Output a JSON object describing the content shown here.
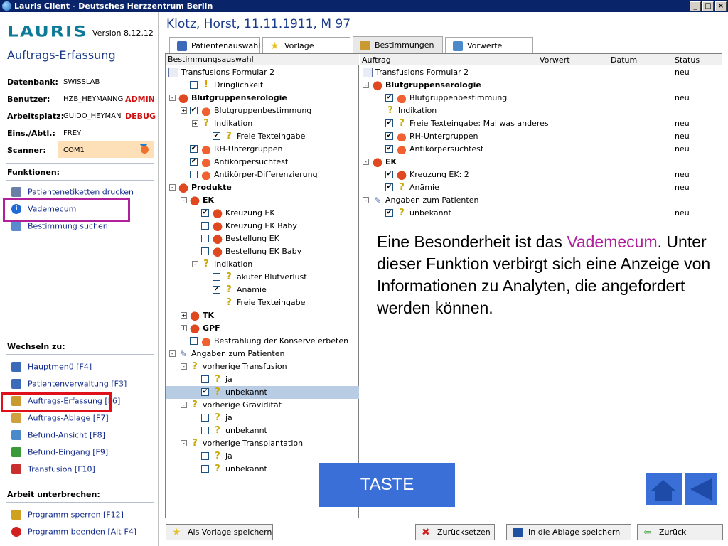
{
  "window": {
    "title": "Lauris Client - Deutsches Herzzentrum Berlin"
  },
  "left": {
    "logo": "LAURIS",
    "version": "Version 8.12.12",
    "module_title": "Auftrags-Erfassung",
    "info": [
      {
        "label": "Datenbank:",
        "value": "SWISSLAB",
        "flag": ""
      },
      {
        "label": "Benutzer:",
        "value": "HZB_HEYMANNG",
        "flag": "ADMIN"
      },
      {
        "label": "Arbeitsplatz:",
        "value": "GUIDO_HEYMAN",
        "flag": "DEBUG"
      },
      {
        "label": "Eins./Abtl.:",
        "value": "FREY",
        "flag": ""
      },
      {
        "label": "Scanner:",
        "value": "COM1",
        "flag": ""
      }
    ],
    "functions_head": "Funktionen:",
    "functions": [
      {
        "label": "Patientenetiketten drucken",
        "icon": "printer-icon"
      },
      {
        "label": "Vademecum",
        "icon": "info-icon"
      },
      {
        "label": "Bestimmung suchen",
        "icon": "magnifier-icon"
      }
    ],
    "switch_head": "Wechseln zu:",
    "switch": [
      {
        "label": "Hauptmenü [F4]",
        "icon": "main-menu-icon"
      },
      {
        "label": "Patientenverwaltung [F3]",
        "icon": "person-icon"
      },
      {
        "label": "Auftrags-Erfassung [F6]",
        "icon": "edit-icon"
      },
      {
        "label": "Auftrags-Ablage [F7]",
        "icon": "archive-icon"
      },
      {
        "label": "Befund-Ansicht [F8]",
        "icon": "report-icon"
      },
      {
        "label": "Befund-Eingang [F9]",
        "icon": "inbox-icon"
      },
      {
        "label": "Transfusion [F10]",
        "icon": "transfusion-icon"
      }
    ],
    "pause_head": "Arbeit unterbrechen:",
    "pause": [
      {
        "label": "Programm sperren [F12]",
        "icon": "lock-icon"
      },
      {
        "label": "Programm beenden [Alt-F4]",
        "icon": "power-icon"
      }
    ]
  },
  "patient": {
    "title": "Klotz, Horst, 11.11.1911, M 97"
  },
  "tabs": [
    {
      "label": "Patientenauswahl",
      "icon": "person-icon"
    },
    {
      "label": "Vorlage",
      "icon": "star-icon"
    },
    {
      "label": "Bestimmungen",
      "icon": "edit-icon"
    },
    {
      "label": "Vorwerte",
      "icon": "report-icon"
    }
  ],
  "left_tree": {
    "header": "Bestimmungsauswahl",
    "rows": [
      {
        "text": "Transfusions Formular 2",
        "icon": "document-icon",
        "checked": null,
        "bold": false
      },
      {
        "text": "Dringlichkeit",
        "icon": "exclamation-icon",
        "checked": false,
        "bold": false
      },
      {
        "text": "Blutgruppenserologie",
        "icon": "blood-bag-icon",
        "checked": null,
        "bold": true
      },
      {
        "text": "Blutgruppenbestimmung",
        "icon": "blood-drop-icon",
        "checked": true,
        "bold": false
      },
      {
        "text": "Indikation",
        "icon": "question-icon",
        "checked": null,
        "bold": false
      },
      {
        "text": "Freie Texteingabe",
        "icon": "question-icon",
        "checked": true,
        "bold": false
      },
      {
        "text": "RH-Untergruppen",
        "icon": "blood-drop-icon",
        "checked": true,
        "bold": false
      },
      {
        "text": "Antikörpersuchtest",
        "icon": "blood-drop-icon",
        "checked": true,
        "bold": false
      },
      {
        "text": "Antikörper-Differenzierung",
        "icon": "blood-drop-icon",
        "checked": false,
        "bold": false
      },
      {
        "text": "Produkte",
        "icon": "blood-bag-icon",
        "checked": null,
        "bold": true
      },
      {
        "text": "EK",
        "icon": "blood-bag-icon",
        "checked": null,
        "bold": true
      },
      {
        "text": "Kreuzung EK",
        "icon": "blood-bag-icon",
        "checked": true,
        "bold": false
      },
      {
        "text": "Kreuzung EK Baby",
        "icon": "blood-bag-icon",
        "checked": false,
        "bold": false
      },
      {
        "text": "Bestellung EK",
        "icon": "blood-bag-icon",
        "checked": false,
        "bold": false
      },
      {
        "text": "Bestellung EK Baby",
        "icon": "blood-bag-icon",
        "checked": false,
        "bold": false
      },
      {
        "text": "Indikation",
        "icon": "question-icon",
        "checked": null,
        "bold": false
      },
      {
        "text": "akuter Blutverlust",
        "icon": "question-icon",
        "checked": false,
        "bold": false
      },
      {
        "text": "Anämie",
        "icon": "question-icon",
        "checked": true,
        "bold": false
      },
      {
        "text": "Freie Texteingabe",
        "icon": "question-icon",
        "checked": false,
        "bold": false
      },
      {
        "text": "TK",
        "icon": "blood-bag-icon",
        "checked": null,
        "bold": true
      },
      {
        "text": "GPF",
        "icon": "blood-bag-icon",
        "checked": null,
        "bold": true
      },
      {
        "text": "Bestrahlung der Konserve erbeten",
        "icon": "blood-drop-icon",
        "checked": false,
        "bold": false
      },
      {
        "text": "Angaben zum Patienten",
        "icon": "syringe-icon",
        "checked": null,
        "bold": false
      },
      {
        "text": "vorherige Transfusion",
        "icon": "question-icon",
        "checked": null,
        "bold": false
      },
      {
        "text": "ja",
        "icon": "question-icon",
        "checked": false,
        "bold": false
      },
      {
        "text": "unbekannt",
        "icon": "question-icon",
        "checked": true,
        "bold": false
      },
      {
        "text": "vorherige Gravidität",
        "icon": "question-icon",
        "checked": null,
        "bold": false
      },
      {
        "text": "ja",
        "icon": "question-icon",
        "checked": false,
        "bold": false
      },
      {
        "text": "unbekannt",
        "icon": "question-icon",
        "checked": false,
        "bold": false
      },
      {
        "text": "vorherige Transplantation",
        "icon": "question-icon",
        "checked": null,
        "bold": false
      },
      {
        "text": "ja",
        "icon": "question-icon",
        "checked": false,
        "bold": false
      },
      {
        "text": "unbekannt",
        "icon": "question-icon",
        "checked": false,
        "bold": false
      }
    ]
  },
  "right_table": {
    "headers": [
      "Auftrag",
      "Vorwert",
      "Datum",
      "Status"
    ],
    "rows": [
      {
        "text": "Transfusions Formular 2",
        "icon": "document-icon",
        "checked": null,
        "bold": false,
        "status": "neu"
      },
      {
        "text": "Blutgruppenserologie",
        "icon": "blood-bag-icon",
        "checked": null,
        "bold": true,
        "status": ""
      },
      {
        "text": "Blutgruppenbestimmung",
        "icon": "blood-drop-icon",
        "checked": true,
        "bold": false,
        "status": "neu"
      },
      {
        "text": "Indikation",
        "icon": "question-icon",
        "checked": null,
        "bold": false,
        "status": ""
      },
      {
        "text": "Freie Texteingabe: Mal was anderes",
        "icon": "question-icon",
        "checked": true,
        "bold": false,
        "status": "neu"
      },
      {
        "text": "RH-Untergruppen",
        "icon": "blood-drop-icon",
        "checked": true,
        "bold": false,
        "status": "neu"
      },
      {
        "text": "Antikörpersuchtest",
        "icon": "blood-drop-icon",
        "checked": true,
        "bold": false,
        "status": "neu"
      },
      {
        "text": "EK",
        "icon": "blood-bag-icon",
        "checked": null,
        "bold": true,
        "status": ""
      },
      {
        "text": "Kreuzung EK: 2",
        "icon": "blood-bag-icon",
        "checked": true,
        "bold": false,
        "status": "neu"
      },
      {
        "text": "Anämie",
        "icon": "question-icon",
        "checked": true,
        "bold": false,
        "status": "neu"
      },
      {
        "text": "Angaben zum Patienten",
        "icon": "syringe-icon",
        "checked": null,
        "bold": false,
        "status": ""
      },
      {
        "text": "unbekannt",
        "icon": "question-icon",
        "checked": true,
        "bold": false,
        "status": "neu"
      }
    ]
  },
  "overlay": {
    "text_before": "Eine Besonderheit ist das ",
    "text_highlight": "Vademecum",
    "text_after": ". Unter dieser Funktion verbirgt sich eine Anzeige von Informationen zu Analyten, die angefordert werden können.",
    "taste": "TASTE"
  },
  "bottom_buttons": [
    {
      "label": "Als Vorlage speichern",
      "icon": "star-icon"
    },
    {
      "label": "Zurücksetzen",
      "icon": "red-x-icon"
    },
    {
      "label": "In die Ablage speichern",
      "icon": "save-icon"
    },
    {
      "label": "Zurück",
      "icon": "back-arrow-icon"
    }
  ],
  "colors": {
    "highlight_vademecum": "#b0209a",
    "highlight_active": "#e0101a",
    "accent": "#3b6fd8"
  }
}
